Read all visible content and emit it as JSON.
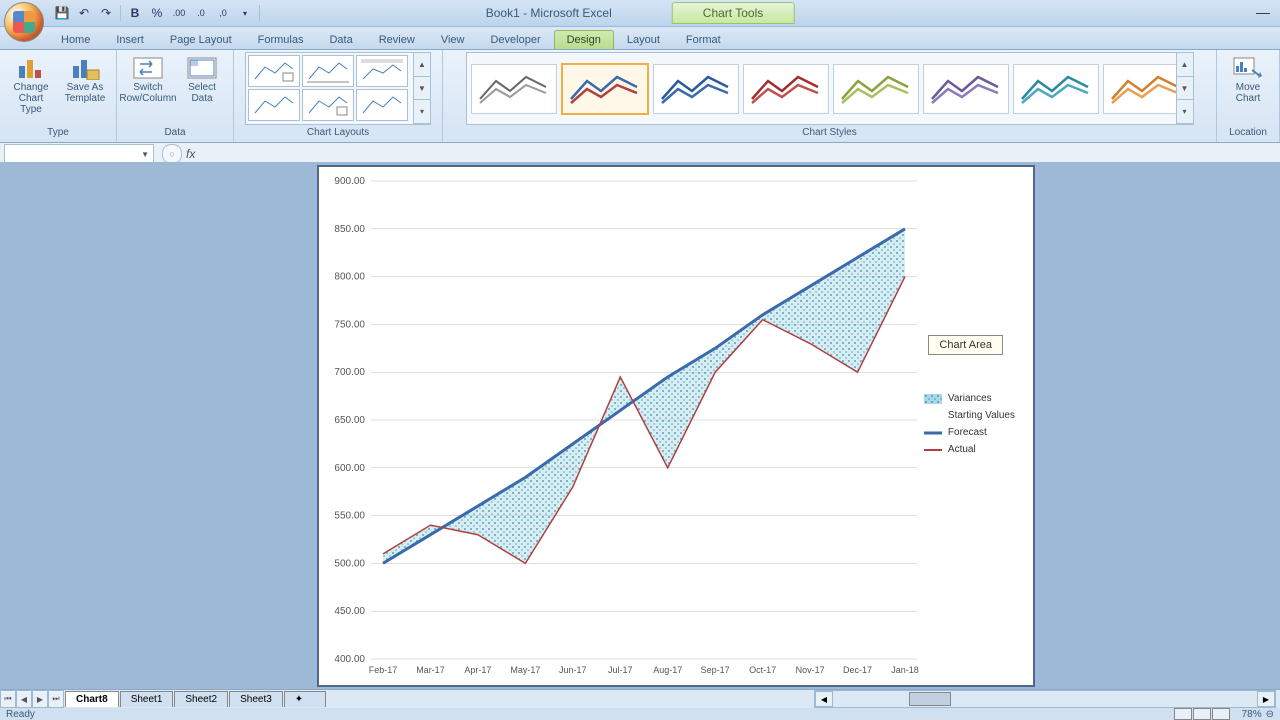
{
  "title": "Book1 - Microsoft Excel",
  "chart_tools_label": "Chart Tools",
  "tabs": {
    "home": "Home",
    "insert": "Insert",
    "page_layout": "Page Layout",
    "formulas": "Formulas",
    "data": "Data",
    "review": "Review",
    "view": "View",
    "developer": "Developer",
    "design": "Design",
    "layout": "Layout",
    "format": "Format"
  },
  "ribbon": {
    "type": {
      "label": "Type",
      "change": "Change Chart Type",
      "save": "Save As Template"
    },
    "data": {
      "label": "Data",
      "switch": "Switch Row/Column",
      "select": "Select Data"
    },
    "layouts": {
      "label": "Chart Layouts"
    },
    "styles": {
      "label": "Chart Styles"
    },
    "location": {
      "label": "Location",
      "move": "Move Chart"
    }
  },
  "tooltip": "Chart Area",
  "legend": {
    "variances": "Variances",
    "starting": "Starting Values",
    "forecast": "Forecast",
    "actual": "Actual"
  },
  "sheets": {
    "active": "Chart8",
    "s1": "Sheet1",
    "s2": "Sheet2",
    "s3": "Sheet3"
  },
  "status": {
    "ready": "Ready",
    "zoom": "78%"
  },
  "chart_data": {
    "type": "line",
    "categories": [
      "Feb-17",
      "Mar-17",
      "Apr-17",
      "May-17",
      "Jun-17",
      "Jul-17",
      "Aug-17",
      "Sep-17",
      "Oct-17",
      "Nov-17",
      "Dec-17",
      "Jan-18"
    ],
    "series": [
      {
        "name": "Forecast",
        "values": [
          500,
          530,
          560,
          590,
          625,
          660,
          695,
          725,
          760,
          790,
          820,
          850
        ]
      },
      {
        "name": "Actual",
        "values": [
          510,
          540,
          530,
          500,
          580,
          695,
          600,
          700,
          755,
          730,
          700,
          800
        ]
      }
    ],
    "ylim": [
      400,
      900
    ],
    "ylabel": "",
    "xlabel": "",
    "y_ticks": [
      "400.00",
      "450.00",
      "500.00",
      "550.00",
      "600.00",
      "650.00",
      "700.00",
      "750.00",
      "800.00",
      "850.00",
      "900.00"
    ],
    "variances_fill": "pattern"
  }
}
